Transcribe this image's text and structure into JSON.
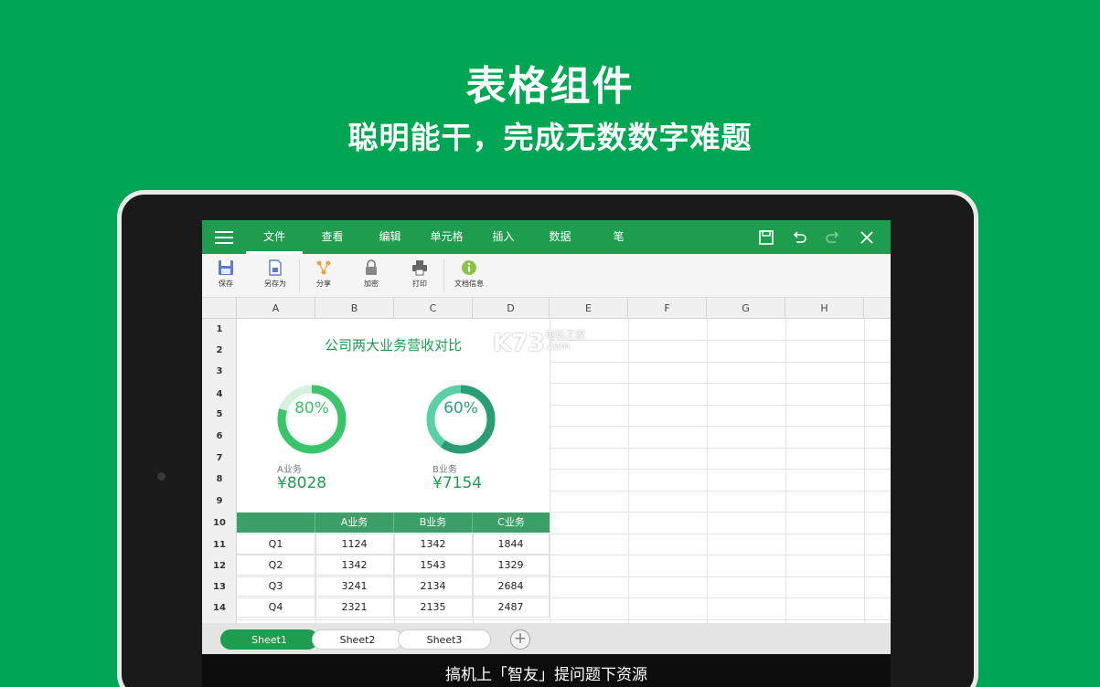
{
  "hero": {
    "title": "表格组件",
    "subtitle": "聪明能干，完成无数数字难题"
  },
  "colors": {
    "background": "#00a651",
    "toolbar": "#1f9d4f",
    "table_header": "#3aa067",
    "ring_a": "#3cc46b",
    "ring_b": "#2aa07a"
  },
  "menu": {
    "tabs": [
      "文件",
      "查看",
      "编辑",
      "单元格",
      "插入",
      "数据",
      "笔"
    ],
    "active": "文件"
  },
  "window_icons": [
    "save-icon",
    "undo-icon",
    "redo-icon",
    "close-icon"
  ],
  "ribbon": [
    {
      "label": "保存",
      "icon": "save-icon"
    },
    {
      "label": "另存为",
      "icon": "save-as-icon"
    },
    {
      "label": "分享",
      "icon": "share-icon"
    },
    {
      "label": "加密",
      "icon": "lock-icon"
    },
    {
      "label": "打印",
      "icon": "printer-icon"
    },
    {
      "label": "文档信息",
      "icon": "info-icon"
    }
  ],
  "columns": [
    "A",
    "B",
    "C",
    "D",
    "E",
    "F",
    "G",
    "H"
  ],
  "rows": [
    "1",
    "2",
    "3",
    "4",
    "5",
    "6",
    "7",
    "8",
    "9",
    "10",
    "11",
    "12",
    "13",
    "14"
  ],
  "dashboard": {
    "title": "公司两大业务营收对比",
    "a": {
      "percent_label": "80%",
      "percent": 0.8,
      "label": "A业务",
      "value": "¥8028"
    },
    "b": {
      "percent_label": "60%",
      "percent": 0.6,
      "label": "B业务",
      "value": "¥7154"
    }
  },
  "table": {
    "headers": [
      "",
      "A业务",
      "B业务",
      "C业务"
    ],
    "rows": [
      [
        "Q1",
        "1124",
        "1342",
        "1844"
      ],
      [
        "Q2",
        "1342",
        "1543",
        "1329"
      ],
      [
        "Q3",
        "3241",
        "2134",
        "2684"
      ],
      [
        "Q4",
        "2321",
        "2135",
        "2487"
      ]
    ]
  },
  "sheets": {
    "tabs": [
      "Sheet1",
      "Sheet2",
      "Sheet3"
    ],
    "active": "Sheet1",
    "add_label": "+"
  },
  "navbar": {
    "text": "搞机上「智友」提问题下资源"
  },
  "watermark": {
    "main": "K73",
    "sub1": "电玩之家",
    "sub2": ".com"
  }
}
